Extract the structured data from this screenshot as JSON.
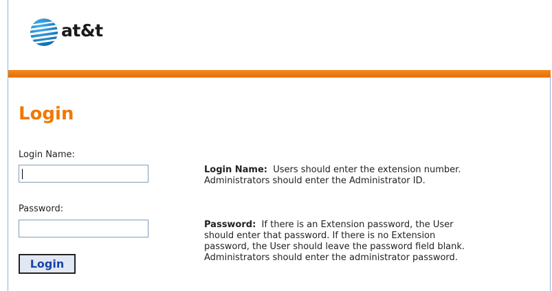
{
  "header": {
    "logo_text": "at&t",
    "logo_icon": "att-globe-icon",
    "accent_color": "#e86d00"
  },
  "page": {
    "title": "Login"
  },
  "form": {
    "login_name_label": "Login Name:",
    "login_name_value": "",
    "password_label": "Password:",
    "password_value": "",
    "submit_label": "Login"
  },
  "help": {
    "login_name_term": "Login Name:",
    "login_name_line1": "  Users should enter the extension number.",
    "login_name_line2": "Administrators should enter the Administrator ID.",
    "password_term": "Password:",
    "password_line1": "  If there is an Extension password, the User",
    "password_line2": "should enter that password. If there is no Extension",
    "password_line3": "password, the User should leave the password field blank.",
    "password_line4": "Administrators should enter the administrator password."
  }
}
